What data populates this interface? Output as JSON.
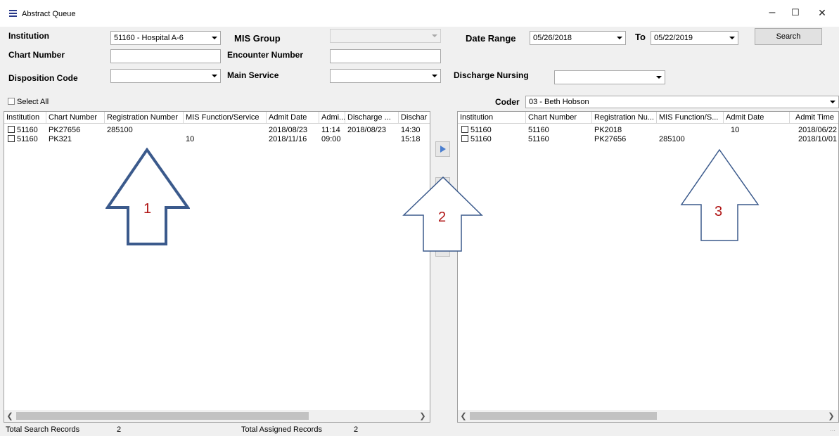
{
  "window": {
    "title": "Abstract Queue",
    "menu_icon": "hamburger-icon",
    "controls": {
      "minimize": "–",
      "maximize": "☐",
      "close": "✕"
    }
  },
  "filters": {
    "institution_label": "Institution",
    "institution_value": "51160 - Hospital A-6",
    "mis_group_label": "MIS Group",
    "mis_group_value": "",
    "date_range_label": "Date Range",
    "date_from": "05/26/2018",
    "to_label": "To",
    "date_to": "05/22/2019",
    "search_label": "Search",
    "chart_number_label": "Chart Number",
    "chart_number_value": "",
    "encounter_number_label": "Encounter Number",
    "encounter_number_value": "",
    "disposition_code_label": "Disposition Code",
    "disposition_code_value": "",
    "main_service_label": "Main Service",
    "main_service_value": "",
    "discharge_nursing_label": "Discharge Nursing",
    "discharge_nursing_value": ""
  },
  "left_panel": {
    "select_all_label": "Select All",
    "columns": [
      "Institution",
      "Chart Number",
      "Registration Number",
      "MIS Function/Service",
      "Admit Date",
      "Admi...",
      "Discharge ...",
      "Dischar"
    ],
    "rows": [
      [
        "51160",
        "PK27656",
        "285100",
        "",
        "2018/08/23",
        "11:14",
        "2018/08/23",
        "14:30"
      ],
      [
        "51160",
        "PK321",
        "",
        "10",
        "2018/11/16",
        "09:00",
        "",
        "15:18"
      ]
    ]
  },
  "right_panel": {
    "coder_label": "Coder",
    "coder_value": "03 - Beth Hobson",
    "columns": [
      "Institution",
      "Chart Number",
      "Registration Nu...",
      "MIS Function/S...",
      "Admit Date",
      "Admit Time"
    ],
    "rows": [
      [
        "51160",
        "51160",
        "PK2018",
        "",
        "10",
        "2018/06/22"
      ],
      [
        "51160",
        "51160",
        "PK27656",
        "285100",
        "",
        "2018/10/01"
      ]
    ]
  },
  "callouts": [
    "1",
    "2",
    "3"
  ],
  "status": {
    "total_search_label": "Total Search Records",
    "total_search_value": "2",
    "total_assigned_label": "Total Assigned Records",
    "total_assigned_value": "2"
  },
  "colors": {
    "arrow_stroke": "#3b5a8c",
    "callout_number": "#b01515",
    "move_button_arrow": "#4a7ecf"
  }
}
